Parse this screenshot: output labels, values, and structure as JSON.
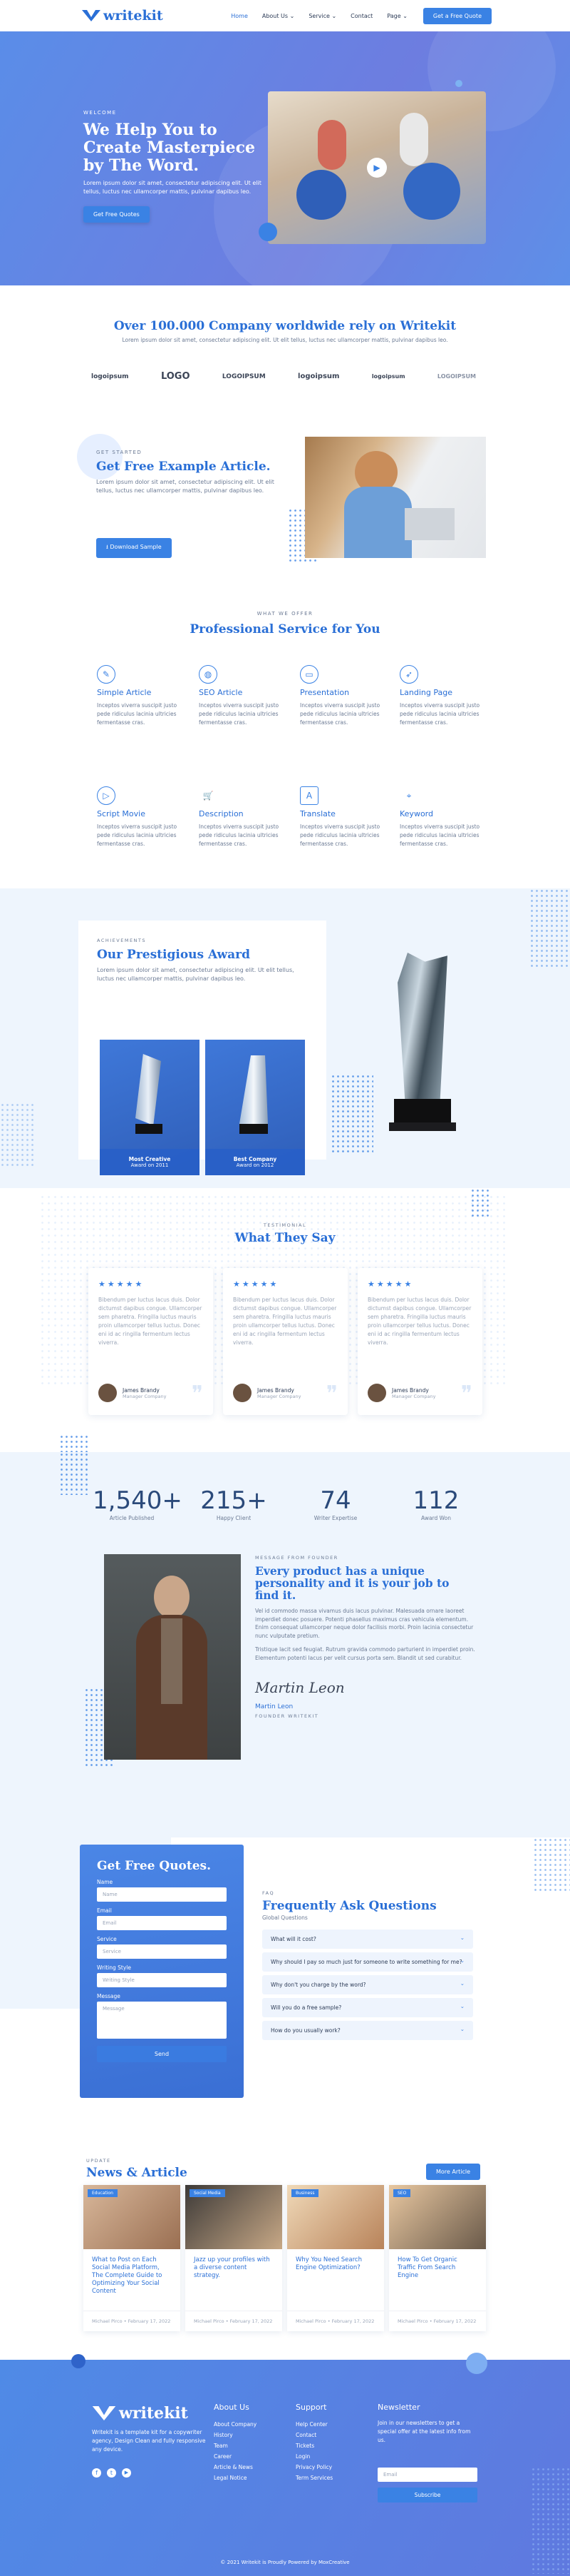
{
  "header": {
    "logo": "writekit",
    "nav": [
      "Home",
      "About Us",
      "Service",
      "Contact",
      "Page"
    ],
    "cta": "Get a Free Quote"
  },
  "hero": {
    "eyebrow": "WELCOME",
    "title": "We Help You to Create Masterpiece by The Word.",
    "text": "Lorem ipsum dolor sit amet, consectetur adipiscing elit. Ut elit tellus, luctus nec ullamcorper mattis, pulvinar dapibus leo.",
    "button": "Get Free Quotes"
  },
  "trust": {
    "title": "Over 100.000 Company worldwide rely on Writekit",
    "text": "Lorem ipsum dolor sit amet, consectetur adipiscing elit. Ut elit tellus, luctus nec ullamcorper mattis, pulvinar dapibus leo.",
    "logos": [
      "logoipsum",
      "LOGO",
      "LOGOIPSUM",
      "logoipsum",
      "logoipsum",
      "LOGOIPSUM"
    ]
  },
  "getstarted": {
    "eyebrow": "GET STARTED",
    "title": "Get Free Example Article.",
    "text": "Lorem ipsum dolor sit amet, consectetur adipiscing elit. Ut elit tellus, luctus nec ullamcorper mattis, pulvinar dapibus leo.",
    "button": "Download Sample"
  },
  "services": {
    "eyebrow": "WHAT WE OFFER",
    "title": "Professional Service for You",
    "desc": "Inceptos viverra suscipit justo pede ridiculus lacinia ultricies fermentasse cras.",
    "items": [
      {
        "name": "Simple Article",
        "icon": "feather-icon"
      },
      {
        "name": "SEO Article",
        "icon": "globe-icon"
      },
      {
        "name": "Presentation",
        "icon": "presentation-icon"
      },
      {
        "name": "Landing Page",
        "icon": "rocket-icon"
      },
      {
        "name": "Script Movie",
        "icon": "play-icon"
      },
      {
        "name": "Description",
        "icon": "cart-icon"
      },
      {
        "name": "Translate",
        "icon": "translate-icon"
      },
      {
        "name": "Keyword",
        "icon": "keyword-icon"
      }
    ]
  },
  "awards": {
    "eyebrow": "ACHIEVEMENTS",
    "title": "Our Prestigious Award",
    "text": "Lorem ipsum dolor sit amet, consectetur adipiscing elit. Ut elit tellus, luctus nec ullamcorper mattis, pulvinar dapibus leo.",
    "items": [
      {
        "name": "Most Creative",
        "year": "Award on 2011"
      },
      {
        "name": "Best Company",
        "year": "Award on 2012"
      }
    ]
  },
  "testimonials": {
    "eyebrow": "TESTIMONIAL",
    "title": "What They Say",
    "stars": "★★★★★",
    "text": "Bibendum per luctus lacus duis. Dolor dictumst dapibus congue. Ullamcorper sem pharetra. Fringilla luctus mauris proin ullamcorper tellus luctus. Donec eni id ac ringilla fermentum lectus viverra.",
    "cards": [
      {
        "name": "James Brandy",
        "role": "Manager Company"
      },
      {
        "name": "James Brandy",
        "role": "Manager Company"
      },
      {
        "name": "James Brandy",
        "role": "Manager Company"
      }
    ]
  },
  "stats": [
    {
      "value": "1,540+",
      "label": "Article Published"
    },
    {
      "value": "215+",
      "label": "Happy Client"
    },
    {
      "value": "74",
      "label": "Writer Expertise"
    },
    {
      "value": "112",
      "label": "Award Won"
    }
  ],
  "founder": {
    "eyebrow": "MESSAGE FROM FOUNDER",
    "title": "Every product has a unique personality and it is your job to find it.",
    "p1": "Vel id commodo massa vivamus duis lacus pulvinar. Malesuada ornare laoreet imperdiet donec posuere. Potenti phasellus maximus cras vehicula elementum. Enim consequat ullamcorper neque dolor facilisis morbi. Proin lacinia consectetur nunc vulputate pretium.",
    "p2": "Tristique lacit sed feugiat. Rutrum gravida commodo parturient in imperdiet proin. Elementum potenti lacus per velit cursus porta sem. Blandit ut sed curabitur.",
    "signature": "Martin Leon",
    "name": "Martin Leon",
    "role": "FOUNDER WRITEKIT"
  },
  "quote": {
    "title": "Get Free Quotes.",
    "fields": [
      {
        "label": "Name",
        "placeholder": "Name"
      },
      {
        "label": "Email",
        "placeholder": "Email"
      },
      {
        "label": "Service",
        "placeholder": "Service"
      },
      {
        "label": "Writing Style",
        "placeholder": "Writing Style"
      }
    ],
    "message_label": "Message",
    "message_placeholder": "Message",
    "button": "Send"
  },
  "faq": {
    "eyebrow": "FAQ",
    "title": "Frequently Ask Questions",
    "sub": "Global Questions",
    "items": [
      "What will it cost?",
      "Why should I pay so much just for someone to write something for me?",
      "Why don't you charge by the word?",
      "Will you do a free sample?",
      "How do you usually work?"
    ]
  },
  "news": {
    "eyebrow": "UPDATE",
    "title": "News & Article",
    "button": "More Article",
    "posts": [
      {
        "tag": "Education",
        "title": "What to Post on Each Social Media Platform, The Complete Guide to Optimizing Your Social Content",
        "meta": "Michael Pirco • February 17, 2022"
      },
      {
        "tag": "Social Media",
        "title": "Jazz up your profiles with a diverse content strategy.",
        "meta": "Michael Pirco • February 17, 2022"
      },
      {
        "tag": "Business",
        "title": "Why You Need Search Engine Optimization?",
        "meta": "Michael Pirco • February 17, 2022"
      },
      {
        "tag": "SEO",
        "title": "How To Get Organic Traffic From Search Engine",
        "meta": "Michael Pirco • February 17, 2022"
      }
    ]
  },
  "footer": {
    "logo": "writekit",
    "about": "Writekit is a template kit for a copywriter agency, Design Clean and fully responsive any device.",
    "cols": [
      {
        "title": "About Us",
        "items": [
          "About Company",
          "History",
          "Team",
          "Career",
          "Article & News",
          "Legal Notice"
        ]
      },
      {
        "title": "Support",
        "items": [
          "Help Center",
          "Contact",
          "Tickets",
          "Login",
          "Privacy Policy",
          "Term Services"
        ]
      }
    ],
    "newsletter_title": "Newsletter",
    "newsletter_text": "Join in our newsletters to get a special offer at the latest info from us.",
    "email_placeholder": "Email",
    "subscribe": "Subscribe",
    "copyright": "© 2021 Writekit is Proudly Powered by MoxCreative"
  }
}
